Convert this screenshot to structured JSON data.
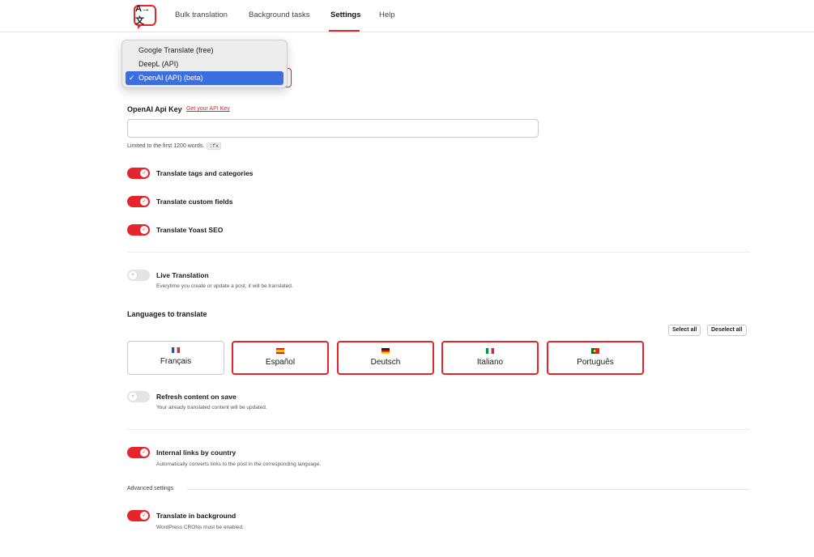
{
  "nav": {
    "logo_text": "A→文",
    "items": [
      "Bulk translation",
      "Background tasks",
      "Settings",
      "Help"
    ],
    "active": "Settings"
  },
  "provider": {
    "options": [
      "Google Translate (free)",
      "DeepL (API)",
      "OpenAI (API) (beta)"
    ],
    "selected": "OpenAI (API) (beta)"
  },
  "api_key": {
    "label": "OpenAI Api Key",
    "link": "Get your API Key",
    "value": "",
    "hint": "Limited to the first 1200 words.",
    "hint_tag": ":fx"
  },
  "toggles": {
    "tags": {
      "label": "Translate tags and categories",
      "on": true
    },
    "custom_fields": {
      "label": "Translate custom fields",
      "on": true
    },
    "yoast": {
      "label": "Translate Yoast SEO",
      "on": true
    },
    "live": {
      "label": "Live Translation",
      "desc": "Everytime you create or update a post, it will be translated.",
      "on": false
    },
    "refresh": {
      "label": "Refresh content on save",
      "desc": "Your already translated content will be updated.",
      "on": false
    },
    "internal_links": {
      "label": "Internal links by country",
      "desc": "Automatically converts links to the post in the corresponding language.",
      "on": true
    },
    "background": {
      "label": "Translate in background",
      "desc": "WordPress CRONs must be enabled.",
      "on": true
    }
  },
  "languages": {
    "heading": "Languages to translate",
    "select_all": "Select all",
    "deselect_all": "Deselect all",
    "items": [
      {
        "name": "Français",
        "selected": false
      },
      {
        "name": "Español",
        "selected": true
      },
      {
        "name": "Deutsch",
        "selected": true
      },
      {
        "name": "Italiano",
        "selected": true
      },
      {
        "name": "Português",
        "selected": true
      }
    ]
  },
  "advanced": {
    "label": "Advanced settings"
  },
  "colors": {
    "accent": "#e5242b",
    "select_highlight": "#3b6fe0"
  }
}
